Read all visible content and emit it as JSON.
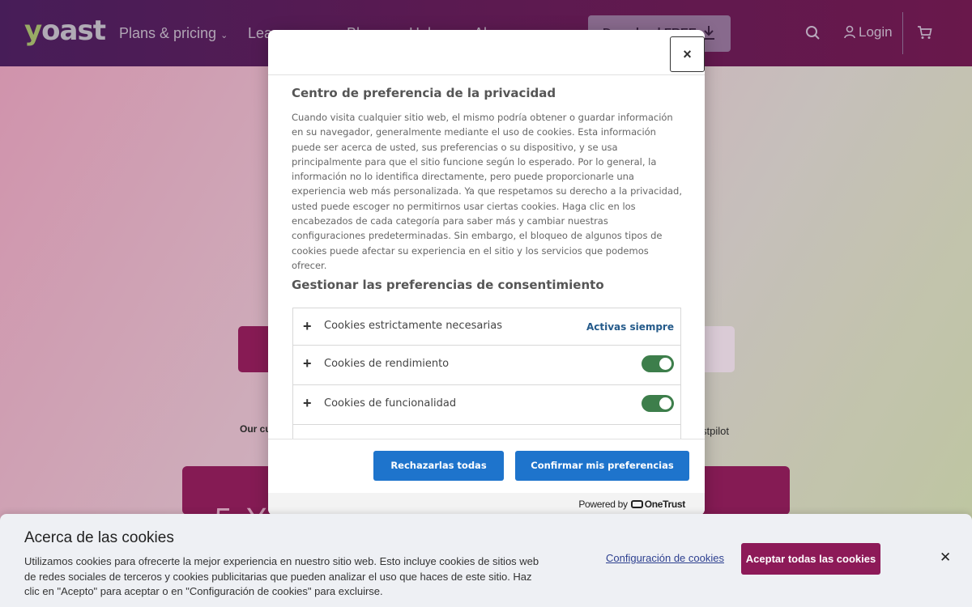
{
  "header": {
    "logo": "yoast",
    "nav_items": [
      "Plans & pricing",
      "Lea",
      "Bl",
      "Hel",
      "Ab"
    ],
    "download_label": "Download FREE",
    "login_label": "Login"
  },
  "background": {
    "left_text": "Our cu",
    "right_text": "stpilot",
    "promo_text": "5 Y"
  },
  "modal": {
    "close_label": "×",
    "title": "Centro de preferencia de la privacidad",
    "description": "Cuando visita cualquier sitio web, el mismo podría obtener o guardar información en su navegador, generalmente mediante el uso de cookies. Esta información puede ser acerca de usted, sus preferencias o su dispositivo, y se usa principalmente para que el sitio funcione según lo esperado. Por lo general, la información no lo identifica directamente, pero puede proporcionarle una experiencia web más personalizada. Ya que respetamos su derecho a la privacidad, usted puede escoger no permitirnos usar ciertas cookies. Haga clic en los encabezados de cada categoría para saber más y cambiar nuestras configuraciones predeterminadas. Sin embargo, el bloqueo de algunos tipos de cookies puede afectar su experiencia en el sitio y los servicios que podemos ofrecer.",
    "subtitle": "Gestionar las preferencias de consentimiento",
    "categories": [
      {
        "label": "Cookies estrictamente necesarias",
        "status": "Activas siempre"
      },
      {
        "label": "Cookies de rendimiento",
        "enabled": true
      },
      {
        "label": "Cookies de funcionalidad",
        "enabled": true
      }
    ],
    "reject_label": "Rechazarlas todas",
    "confirm_label": "Confirmar mis preferencias",
    "powered_by": "Powered by",
    "powered_brand": "OneTrust"
  },
  "cookie_bar": {
    "title": "Acerca de las cookies",
    "text": "Utilizamos cookies para ofrecerte la mejor experiencia en nuestro sitio web. Esto incluye cookies de sitios web de redes sociales de terceros y cookies publicitarias que pueden analizar el uso que haces de este sitio. Haz clic en \"Acepto\" para aceptar o en \"Configuración de cookies\" para excluirse.",
    "settings_label": "Configuración de cookies",
    "accept_label": "Aceptar todas las cookies",
    "close_label": "✕"
  },
  "colors": {
    "accent_magenta": "#8d1a58",
    "button_blue": "#1e74cc",
    "toggle_green": "#3d7e4b",
    "link_blue": "#245a8a"
  }
}
